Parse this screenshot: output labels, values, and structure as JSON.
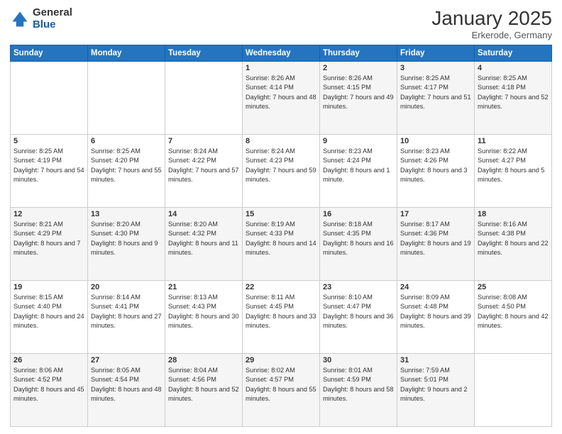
{
  "header": {
    "logo": {
      "general": "General",
      "blue": "Blue"
    },
    "title": "January 2025",
    "location": "Erkerode, Germany"
  },
  "weekdays": [
    "Sunday",
    "Monday",
    "Tuesday",
    "Wednesday",
    "Thursday",
    "Friday",
    "Saturday"
  ],
  "weeks": [
    [
      {
        "day": "",
        "content": ""
      },
      {
        "day": "",
        "content": ""
      },
      {
        "day": "",
        "content": ""
      },
      {
        "day": "1",
        "content": "Sunrise: 8:26 AM\nSunset: 4:14 PM\nDaylight: 7 hours\nand 48 minutes."
      },
      {
        "day": "2",
        "content": "Sunrise: 8:26 AM\nSunset: 4:15 PM\nDaylight: 7 hours\nand 49 minutes."
      },
      {
        "day": "3",
        "content": "Sunrise: 8:25 AM\nSunset: 4:17 PM\nDaylight: 7 hours\nand 51 minutes."
      },
      {
        "day": "4",
        "content": "Sunrise: 8:25 AM\nSunset: 4:18 PM\nDaylight: 7 hours\nand 52 minutes."
      }
    ],
    [
      {
        "day": "5",
        "content": "Sunrise: 8:25 AM\nSunset: 4:19 PM\nDaylight: 7 hours\nand 54 minutes."
      },
      {
        "day": "6",
        "content": "Sunrise: 8:25 AM\nSunset: 4:20 PM\nDaylight: 7 hours\nand 55 minutes."
      },
      {
        "day": "7",
        "content": "Sunrise: 8:24 AM\nSunset: 4:22 PM\nDaylight: 7 hours\nand 57 minutes."
      },
      {
        "day": "8",
        "content": "Sunrise: 8:24 AM\nSunset: 4:23 PM\nDaylight: 7 hours\nand 59 minutes."
      },
      {
        "day": "9",
        "content": "Sunrise: 8:23 AM\nSunset: 4:24 PM\nDaylight: 8 hours\nand 1 minute."
      },
      {
        "day": "10",
        "content": "Sunrise: 8:23 AM\nSunset: 4:26 PM\nDaylight: 8 hours\nand 3 minutes."
      },
      {
        "day": "11",
        "content": "Sunrise: 8:22 AM\nSunset: 4:27 PM\nDaylight: 8 hours\nand 5 minutes."
      }
    ],
    [
      {
        "day": "12",
        "content": "Sunrise: 8:21 AM\nSunset: 4:29 PM\nDaylight: 8 hours\nand 7 minutes."
      },
      {
        "day": "13",
        "content": "Sunrise: 8:20 AM\nSunset: 4:30 PM\nDaylight: 8 hours\nand 9 minutes."
      },
      {
        "day": "14",
        "content": "Sunrise: 8:20 AM\nSunset: 4:32 PM\nDaylight: 8 hours\nand 11 minutes."
      },
      {
        "day": "15",
        "content": "Sunrise: 8:19 AM\nSunset: 4:33 PM\nDaylight: 8 hours\nand 14 minutes."
      },
      {
        "day": "16",
        "content": "Sunrise: 8:18 AM\nSunset: 4:35 PM\nDaylight: 8 hours\nand 16 minutes."
      },
      {
        "day": "17",
        "content": "Sunrise: 8:17 AM\nSunset: 4:36 PM\nDaylight: 8 hours\nand 19 minutes."
      },
      {
        "day": "18",
        "content": "Sunrise: 8:16 AM\nSunset: 4:38 PM\nDaylight: 8 hours\nand 22 minutes."
      }
    ],
    [
      {
        "day": "19",
        "content": "Sunrise: 8:15 AM\nSunset: 4:40 PM\nDaylight: 8 hours\nand 24 minutes."
      },
      {
        "day": "20",
        "content": "Sunrise: 8:14 AM\nSunset: 4:41 PM\nDaylight: 8 hours\nand 27 minutes."
      },
      {
        "day": "21",
        "content": "Sunrise: 8:13 AM\nSunset: 4:43 PM\nDaylight: 8 hours\nand 30 minutes."
      },
      {
        "day": "22",
        "content": "Sunrise: 8:11 AM\nSunset: 4:45 PM\nDaylight: 8 hours\nand 33 minutes."
      },
      {
        "day": "23",
        "content": "Sunrise: 8:10 AM\nSunset: 4:47 PM\nDaylight: 8 hours\nand 36 minutes."
      },
      {
        "day": "24",
        "content": "Sunrise: 8:09 AM\nSunset: 4:48 PM\nDaylight: 8 hours\nand 39 minutes."
      },
      {
        "day": "25",
        "content": "Sunrise: 8:08 AM\nSunset: 4:50 PM\nDaylight: 8 hours\nand 42 minutes."
      }
    ],
    [
      {
        "day": "26",
        "content": "Sunrise: 8:06 AM\nSunset: 4:52 PM\nDaylight: 8 hours\nand 45 minutes."
      },
      {
        "day": "27",
        "content": "Sunrise: 8:05 AM\nSunset: 4:54 PM\nDaylight: 8 hours\nand 48 minutes."
      },
      {
        "day": "28",
        "content": "Sunrise: 8:04 AM\nSunset: 4:56 PM\nDaylight: 8 hours\nand 52 minutes."
      },
      {
        "day": "29",
        "content": "Sunrise: 8:02 AM\nSunset: 4:57 PM\nDaylight: 8 hours\nand 55 minutes."
      },
      {
        "day": "30",
        "content": "Sunrise: 8:01 AM\nSunset: 4:59 PM\nDaylight: 8 hours\nand 58 minutes."
      },
      {
        "day": "31",
        "content": "Sunrise: 7:59 AM\nSunset: 5:01 PM\nDaylight: 9 hours\nand 2 minutes."
      },
      {
        "day": "",
        "content": ""
      }
    ]
  ]
}
